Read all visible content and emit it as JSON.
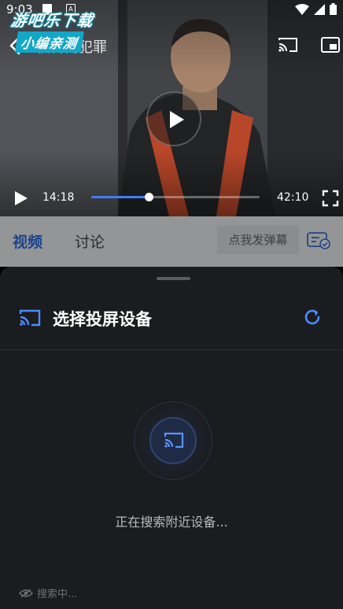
{
  "status_bar": {
    "time": "9:03",
    "notif_icon": "A"
  },
  "watermark": {
    "line1": "游吧乐下载",
    "line2": "小编亲测"
  },
  "player": {
    "title": "低智商犯罪",
    "current_time": "14:18",
    "total_time": "42:10",
    "progress": 0.34,
    "accent_color": "#3f7df5"
  },
  "tabs": {
    "items": [
      {
        "label": "视频",
        "active": true
      },
      {
        "label": "讨论",
        "active": false
      }
    ],
    "danmu_placeholder": "点我发弹幕"
  },
  "cast_sheet": {
    "title": "选择投屏设备",
    "searching_message": "正在搜索附近设备...",
    "footer_status": "搜索中..."
  },
  "icons": {
    "back": "chevron-left-icon",
    "cast": "cast-icon",
    "pip": "picture-in-picture-icon",
    "play": "play-icon",
    "fullscreen": "fullscreen-icon",
    "refresh": "refresh-icon",
    "danmu": "danmu-toggle-icon",
    "eye": "eye-icon"
  }
}
